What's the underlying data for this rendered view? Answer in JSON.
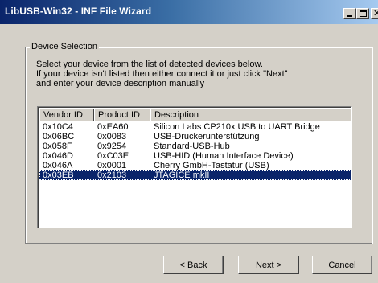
{
  "window": {
    "title": "LibUSB-Win32 - INF File Wizard"
  },
  "group": {
    "label": "Device Selection"
  },
  "instructions": [
    "Select your device from the list of detected devices below.",
    "If your device isn't listed then either connect it or just click \"Next\"",
    "and enter your device description manually"
  ],
  "list": {
    "columns": [
      "Vendor ID",
      "Product ID",
      "Description"
    ],
    "rows": [
      [
        "0x10C4",
        "0xEA60",
        "Silicon Labs CP210x USB to UART Bridge"
      ],
      [
        "0x06BC",
        "0x0083",
        "USB-Druckerunterstützung"
      ],
      [
        "0x058F",
        "0x9254",
        "Standard-USB-Hub"
      ],
      [
        "0x046D",
        "0xC03E",
        "USB-HID (Human Interface Device)"
      ],
      [
        "0x046A",
        "0x0001",
        "Cherry GmbH-Tastatur (USB)"
      ],
      [
        "0x03EB",
        "0x2103",
        "JTAGICE mkII"
      ]
    ],
    "selected_index": 5
  },
  "buttons": {
    "back": "< Back",
    "next": "Next >",
    "cancel": "Cancel"
  },
  "colors": {
    "selection": "#0a246a",
    "face": "#d4d0c8"
  }
}
